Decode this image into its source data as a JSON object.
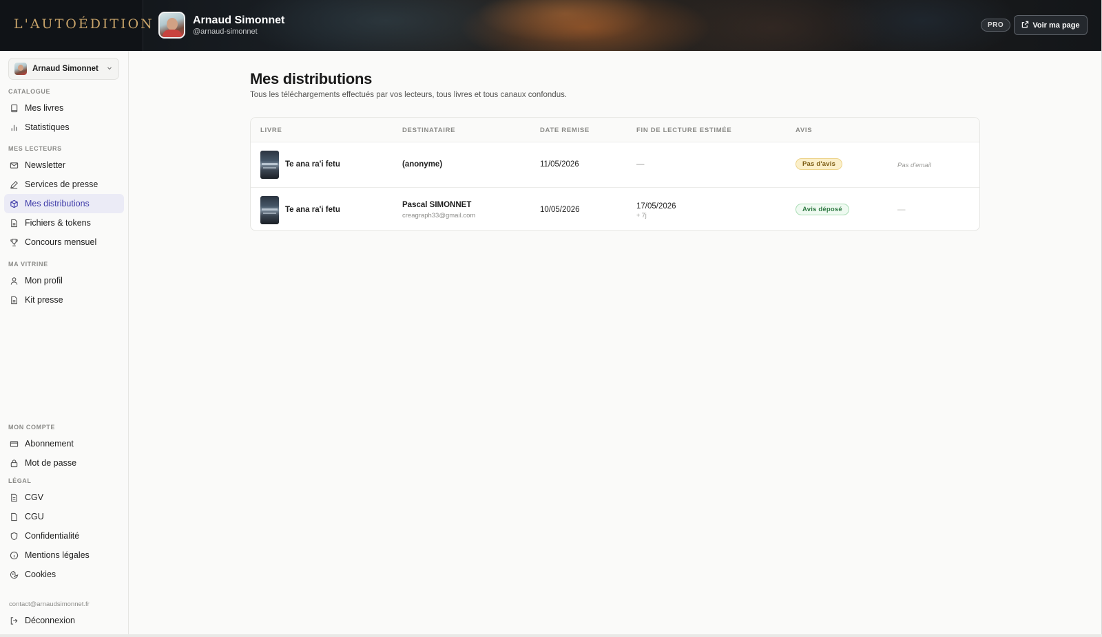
{
  "header": {
    "brand": "L'AUTOÉDITION",
    "profile_name": "Arnaud Simonnet",
    "profile_handle": "@arnaud-simonnet",
    "plan_badge": "PRO",
    "view_page_label": "Voir ma page"
  },
  "sidebar": {
    "account_name": "Arnaud Simonnet",
    "sections": {
      "catalogue": "CATALOGUE",
      "lecteurs": "MES LECTEURS",
      "vitrine": "MA VITRINE",
      "compte": "MON COMPTE",
      "legal": "LÉGAL"
    },
    "items": {
      "livres": "Mes livres",
      "statistiques": "Statistiques",
      "newsletter": "Newsletter",
      "presse": "Services de presse",
      "distributions": "Mes distributions",
      "fichiers": "Fichiers & tokens",
      "concours": "Concours mensuel",
      "profil": "Mon profil",
      "kit": "Kit presse",
      "abonnement": "Abonnement",
      "motdepasse": "Mot de passe",
      "cgv": "CGV",
      "cgu": "CGU",
      "confidentialite": "Confidentialité",
      "mentions": "Mentions légales",
      "cookies": "Cookies",
      "deconnexion": "Déconnexion"
    },
    "contact_email": "contact@arnaudsimonnet.fr"
  },
  "main": {
    "title": "Mes distributions",
    "subtitle": "Tous les téléchargements effectués par vos lecteurs, tous livres et tous canaux confondus.",
    "columns": {
      "livre": "LIVRE",
      "destinataire": "DESTINATAIRE",
      "date": "DATE REMISE",
      "fin": "FIN DE LECTURE ESTIMÉE",
      "avis": "AVIS"
    },
    "rows": [
      {
        "book": "Te ana ra'i fetu",
        "recipient": "(anonyme)",
        "date": "11/05/2026",
        "end": "—",
        "review": "Pas d'avis",
        "extra": "Pas d'email"
      },
      {
        "book": "Te ana ra'i fetu",
        "recipient": "Pascal SIMONNET",
        "recipient_email": "creagraph33@gmail.com",
        "date": "10/05/2026",
        "end": "17/05/2026",
        "end_note": "+ 7j",
        "review": "Avis déposé",
        "extra": "—"
      }
    ]
  }
}
